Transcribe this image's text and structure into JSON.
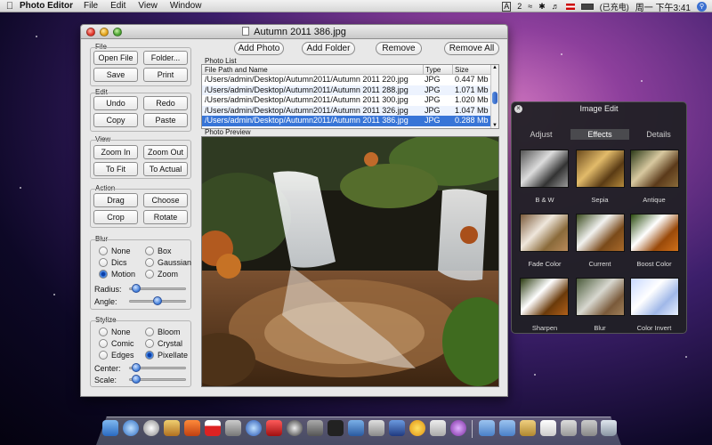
{
  "menubar": {
    "app_name": "Photo Editor",
    "menus": [
      "File",
      "Edit",
      "View",
      "Window"
    ],
    "status": {
      "ime": "A",
      "badge": "2",
      "battery": "(已充电)",
      "clock": "周一 下午3:41"
    }
  },
  "window": {
    "title": "Autumn 2011 386.jpg"
  },
  "file_group": {
    "label": "File",
    "buttons": [
      "Open File",
      "Folder...",
      "Save",
      "Print"
    ]
  },
  "edit_group": {
    "label": "Edit",
    "buttons": [
      "Undo",
      "Redo",
      "Copy",
      "Paste"
    ]
  },
  "view_group": {
    "label": "View",
    "buttons": [
      "Zoom In",
      "Zoom Out",
      "To Fit",
      "To Actual"
    ]
  },
  "action_group": {
    "label": "Action",
    "buttons": [
      "Drag",
      "Choose",
      "Crop",
      "Rotate"
    ]
  },
  "blur_group": {
    "label": "Blur",
    "options": [
      "None",
      "Box",
      "Dics",
      "Gaussian",
      "Motion",
      "Zoom"
    ],
    "selected": "Motion",
    "radius_label": "Radius:",
    "radius_value": 0.05,
    "angle_label": "Angle:",
    "angle_value": 0.5
  },
  "stylize_group": {
    "label": "Stylize",
    "options": [
      "None",
      "Bloom",
      "Comic",
      "Crystal",
      "Edges",
      "Pixellate"
    ],
    "selected": "Pixellate",
    "center_label": "Center:",
    "center_value": 0.05,
    "scale_label": "Scale:",
    "scale_value": 0.05
  },
  "toolbar": {
    "add_photo": "Add Photo",
    "add_folder": "Add Folder",
    "remove": "Remove",
    "remove_all": "Remove All"
  },
  "photo_list": {
    "label": "Photo List",
    "columns": [
      "File Path and Name",
      "Type",
      "Size"
    ],
    "rows": [
      {
        "path": "/Users/admin/Desktop/Autumn2011/Autumn 2011 220.jpg",
        "type": "JPG",
        "size": "0.447 Mb"
      },
      {
        "path": "/Users/admin/Desktop/Autumn2011/Autumn 2011 288.jpg",
        "type": "JPG",
        "size": "1.071 Mb"
      },
      {
        "path": "/Users/admin/Desktop/Autumn2011/Autumn 2011 300.jpg",
        "type": "JPG",
        "size": "1.020 Mb"
      },
      {
        "path": "/Users/admin/Desktop/Autumn2011/Autumn 2011 326.jpg",
        "type": "JPG",
        "size": "1.047 Mb"
      },
      {
        "path": "/Users/admin/Desktop/Autumn2011/Autumn 2011 386.jpg",
        "type": "JPG",
        "size": "0.288 Mb"
      }
    ],
    "selected_index": 4
  },
  "preview": {
    "label": "Photo Preview"
  },
  "image_edit": {
    "title": "Image Edit",
    "tabs": [
      "Adjust",
      "Effects",
      "Details"
    ],
    "active_tab": "Effects",
    "effects": [
      "B & W",
      "Sepia",
      "Antique",
      "Fade Color",
      "Current",
      "Boost Color",
      "Sharpen",
      "Blur",
      "Color Invert"
    ]
  },
  "colors": {
    "selection": "#3875d7",
    "accent": "#2d5fbf"
  }
}
